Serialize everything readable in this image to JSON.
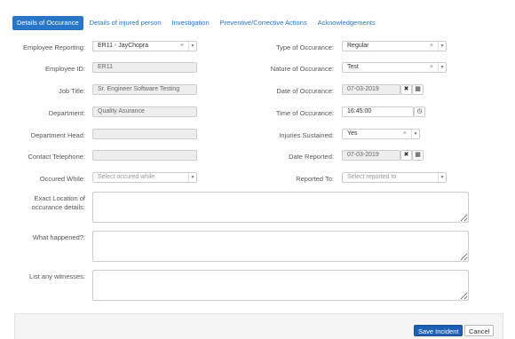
{
  "tabs": [
    {
      "label": "Details of Occurance",
      "active": true
    },
    {
      "label": "Details of injured person"
    },
    {
      "label": "Investigation"
    },
    {
      "label": "Preventive/Corrective Actions"
    },
    {
      "label": "Acknowledgements"
    }
  ],
  "left": {
    "employee_reporting": {
      "label": "Employee Reporting:",
      "value": "ER11 - JayChopra"
    },
    "employee_id": {
      "label": "Employee ID:",
      "value": "ER11"
    },
    "job_title": {
      "label": "Job Title:",
      "value": "Sr. Engineer Software Testing"
    },
    "department": {
      "label": "Department:",
      "value": "Quality Asurance"
    },
    "department_head": {
      "label": "Department Head:",
      "value": ""
    },
    "contact_telephone": {
      "label": "Contact Telephone:",
      "value": ""
    },
    "occured_while": {
      "label": "Occured While:",
      "placeholder": "Select occured while"
    }
  },
  "right": {
    "type_of_occurance": {
      "label": "Type of Occurance:",
      "value": "Regular"
    },
    "nature_of_occurance": {
      "label": "Nature of Occurance:",
      "value": "Test"
    },
    "date_of_occurance": {
      "label": "Date of Occurance:",
      "value": "07-03-2019"
    },
    "time_of_occurance": {
      "label": "Time of Occurance:",
      "value": "16:45:00"
    },
    "injuries_sustained": {
      "label": "Injuries Sustained:",
      "value": "Yes"
    },
    "date_reported": {
      "label": "Date Reported:",
      "value": "07-03-2019"
    },
    "reported_to": {
      "label": "Reported To:",
      "placeholder": "Select reported to"
    }
  },
  "textareas": {
    "exact_location": {
      "label_line1": "Exact Location of",
      "label_line2": "occurance details:"
    },
    "what_happened": {
      "label": "What happened?:"
    },
    "witnesses": {
      "label": "List any witnesses:"
    }
  },
  "footer": {
    "save_label": "Save Incident",
    "cancel_label": "Cancel"
  },
  "glyphs": {
    "clear": "×",
    "caret": "▼",
    "remove": "✖",
    "calendar": "▦",
    "clock": "◷"
  }
}
